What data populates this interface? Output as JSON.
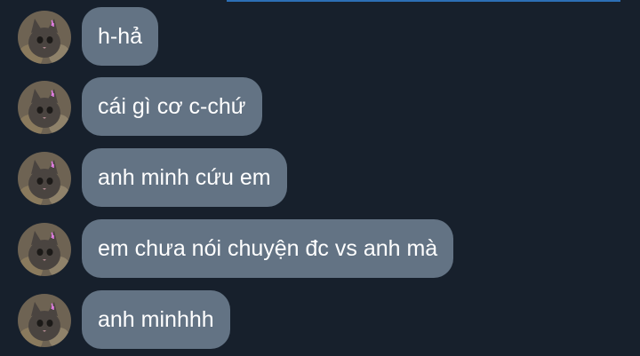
{
  "colors": {
    "background": "#17202c",
    "bubble": "#637384",
    "text": "#ffffff",
    "accent_line": "#2c6fb5"
  },
  "messages": [
    {
      "text": "h-hả",
      "avatar": "cat-avatar"
    },
    {
      "text": "cái gì cơ c-chứ",
      "avatar": "cat-avatar"
    },
    {
      "text": "anh minh cứu em",
      "avatar": "cat-avatar"
    },
    {
      "text": "em chưa nói chuyện đc vs anh mà",
      "avatar": "cat-avatar"
    },
    {
      "text": "anh minhhh",
      "avatar": "cat-avatar"
    }
  ]
}
